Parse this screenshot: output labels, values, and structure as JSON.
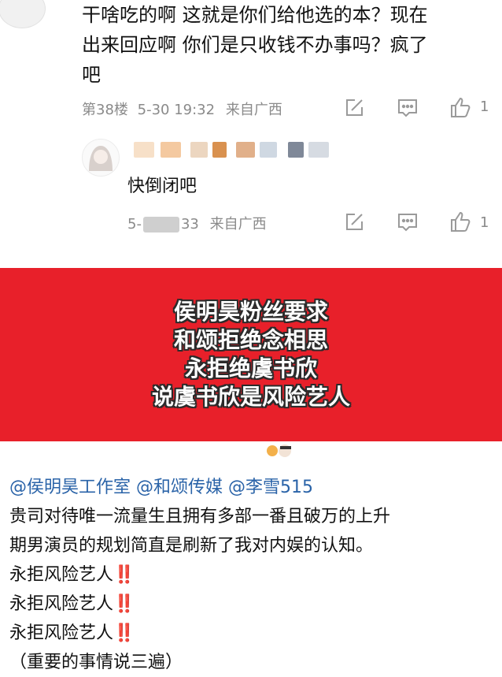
{
  "comment1": {
    "text_lines": [
      "干啥吃的啊 这就是你们给他选的本？现在",
      "出来回应啊 你们是只收钱不办事吗？疯了",
      "吧"
    ],
    "floor": "第38楼",
    "timestamp": "5-30 19:32",
    "location": "来自广西",
    "likes": "1"
  },
  "reply": {
    "text": "快倒闭吧",
    "time_prefix": "5-",
    "time_suffix": "33",
    "location": "来自广西",
    "likes": "1"
  },
  "banner": {
    "lines": [
      "侯明昊粉丝要求",
      "和颂拒绝念相思",
      "永拒绝虞书欣",
      "说虞书欣是风险艺人"
    ],
    "background": "#e8202a"
  },
  "post": {
    "mentions": [
      "@侯明昊工作室",
      "@和颂传媒",
      "@李雪515"
    ],
    "body_lines": [
      "贵司对待唯一流量生且拥有多部一番且破万的上升",
      "期男演员的规划简直是刷新了我对内娱的认知。"
    ],
    "repeat_line": "永拒风险艺人",
    "repeat_mark": "‼️",
    "closing": "（重要的事情说三遍）"
  },
  "icons": {
    "edit": "edit-icon",
    "comment": "comment-icon",
    "like": "thumbs-up-icon"
  }
}
